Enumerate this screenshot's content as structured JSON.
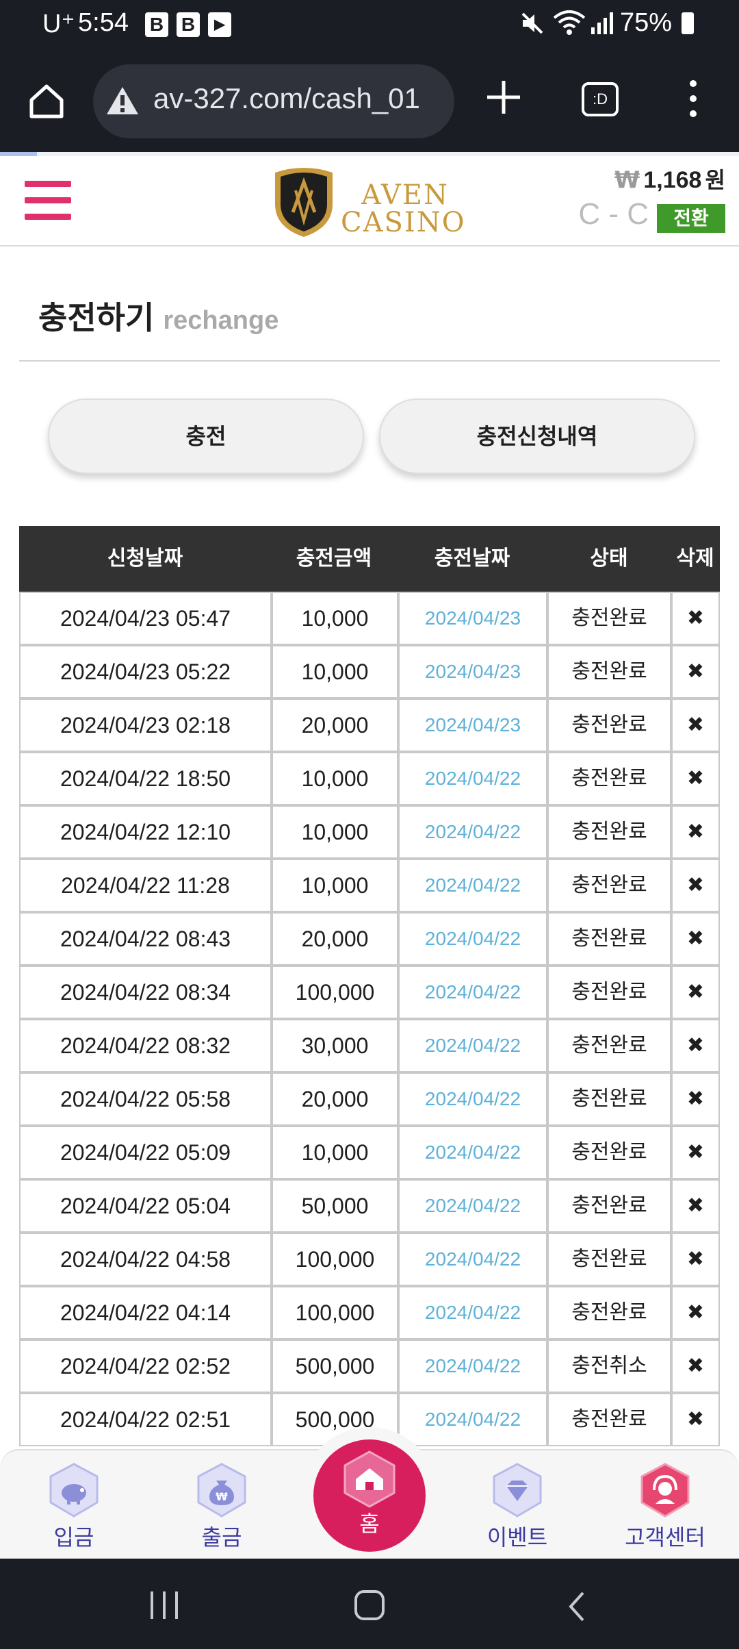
{
  "status_bar": {
    "carrier": "U⁺",
    "time": "5:54",
    "app_icons": [
      "B",
      "B",
      "▶"
    ],
    "battery": "75%"
  },
  "browser": {
    "url": "av-327.com/cash_01",
    "tabs_label": ":D"
  },
  "header": {
    "brand_line1": "AVEN",
    "brand_line2": "CASINO",
    "currency_symbol": "₩",
    "balance": "1,168",
    "balance_unit": "원",
    "cc_text": "C - C",
    "convert_label": "전환"
  },
  "page": {
    "title": "충전하기",
    "subtitle": "rechange"
  },
  "buttons": {
    "charge": "충전",
    "history": "충전신청내역"
  },
  "table": {
    "headers": [
      "신청날짜",
      "충전금액",
      "충전날짜",
      "상태",
      "삭제"
    ],
    "rows": [
      {
        "request_date": "2024/04/23 05:47",
        "amount": "10,000",
        "charge_date": "2024/04/23",
        "status": "충전완료",
        "delete": "✖"
      },
      {
        "request_date": "2024/04/23 05:22",
        "amount": "10,000",
        "charge_date": "2024/04/23",
        "status": "충전완료",
        "delete": "✖"
      },
      {
        "request_date": "2024/04/23 02:18",
        "amount": "20,000",
        "charge_date": "2024/04/23",
        "status": "충전완료",
        "delete": "✖"
      },
      {
        "request_date": "2024/04/22 18:50",
        "amount": "10,000",
        "charge_date": "2024/04/22",
        "status": "충전완료",
        "delete": "✖"
      },
      {
        "request_date": "2024/04/22 12:10",
        "amount": "10,000",
        "charge_date": "2024/04/22",
        "status": "충전완료",
        "delete": "✖"
      },
      {
        "request_date": "2024/04/22 11:28",
        "amount": "10,000",
        "charge_date": "2024/04/22",
        "status": "충전완료",
        "delete": "✖"
      },
      {
        "request_date": "2024/04/22 08:43",
        "amount": "20,000",
        "charge_date": "2024/04/22",
        "status": "충전완료",
        "delete": "✖"
      },
      {
        "request_date": "2024/04/22 08:34",
        "amount": "100,000",
        "charge_date": "2024/04/22",
        "status": "충전완료",
        "delete": "✖"
      },
      {
        "request_date": "2024/04/22 08:32",
        "amount": "30,000",
        "charge_date": "2024/04/22",
        "status": "충전완료",
        "delete": "✖"
      },
      {
        "request_date": "2024/04/22 05:58",
        "amount": "20,000",
        "charge_date": "2024/04/22",
        "status": "충전완료",
        "delete": "✖"
      },
      {
        "request_date": "2024/04/22 05:09",
        "amount": "10,000",
        "charge_date": "2024/04/22",
        "status": "충전완료",
        "delete": "✖"
      },
      {
        "request_date": "2024/04/22 05:04",
        "amount": "50,000",
        "charge_date": "2024/04/22",
        "status": "충전완료",
        "delete": "✖"
      },
      {
        "request_date": "2024/04/22 04:58",
        "amount": "100,000",
        "charge_date": "2024/04/22",
        "status": "충전완료",
        "delete": "✖"
      },
      {
        "request_date": "2024/04/22 04:14",
        "amount": "100,000",
        "charge_date": "2024/04/22",
        "status": "충전완료",
        "delete": "✖"
      },
      {
        "request_date": "2024/04/22 02:52",
        "amount": "500,000",
        "charge_date": "2024/04/22",
        "status": "충전취소",
        "delete": "✖"
      },
      {
        "request_date": "2024/04/22 02:51",
        "amount": "500,000",
        "charge_date": "2024/04/22",
        "status": "충전완료",
        "delete": "✖"
      }
    ]
  },
  "bottom_nav": {
    "deposit": "입금",
    "withdraw": "출금",
    "home": "홈",
    "event": "이벤트",
    "support": "고객센터"
  },
  "colors": {
    "accent": "#e0316b",
    "home_button": "#d81f5e",
    "convert": "#3f9a2a",
    "header_bg": "#323232",
    "charge_date": "#5fb1d8",
    "brand_gold": "#c99a3d"
  },
  "icons": {
    "browser_home": "home-icon",
    "warning": "warning-icon",
    "new_tab": "plus-icon",
    "menu": "more-vertical-icon",
    "hamburger": "hamburger-menu-icon",
    "deposit": "piggy-bank-icon",
    "withdraw": "money-bag-icon",
    "home": "house-icon",
    "event": "diamond-icon",
    "support": "headset-icon"
  }
}
